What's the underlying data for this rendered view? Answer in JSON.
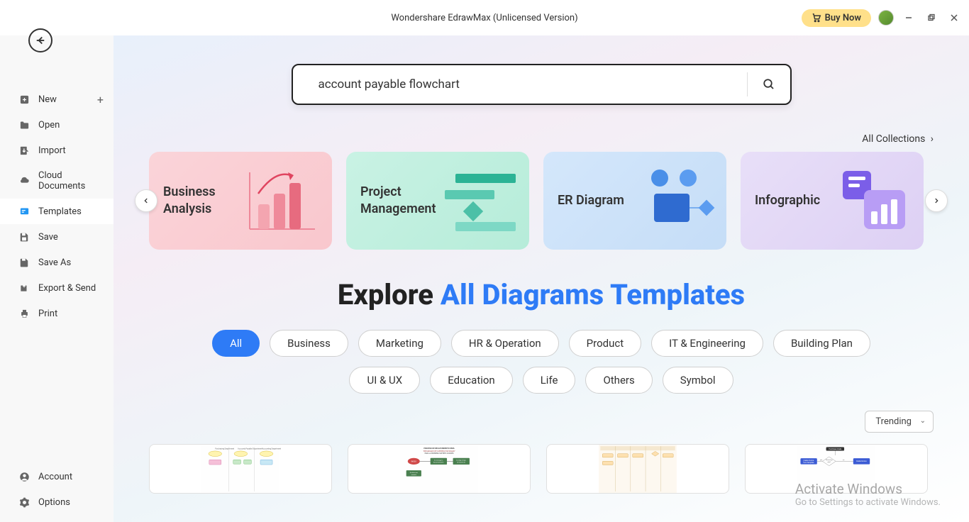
{
  "titlebar": {
    "title": "Wondershare EdrawMax (Unlicensed Version)",
    "buy_now": "Buy Now"
  },
  "sidebar": {
    "items": [
      {
        "label": "New"
      },
      {
        "label": "Open"
      },
      {
        "label": "Import"
      },
      {
        "label": "Cloud Documents"
      },
      {
        "label": "Templates"
      },
      {
        "label": "Save"
      },
      {
        "label": "Save As"
      },
      {
        "label": "Export & Send"
      },
      {
        "label": "Print"
      }
    ],
    "bottom": [
      {
        "label": "Account"
      },
      {
        "label": "Options"
      }
    ]
  },
  "search": {
    "value": "account payable flowchart"
  },
  "all_collections": "All Collections",
  "category_cards": [
    {
      "title": "Business Analysis"
    },
    {
      "title": "Project Management"
    },
    {
      "title": "ER Diagram"
    },
    {
      "title": "Infographic"
    }
  ],
  "explore": {
    "prefix": "Explore ",
    "highlight": "All Diagrams Templates"
  },
  "filter_pills": [
    "All",
    "Business",
    "Marketing",
    "HR & Operation",
    "Product",
    "IT & Engineering",
    "Building Plan",
    "UI & UX",
    "Education",
    "Life",
    "Others",
    "Symbol"
  ],
  "sort": {
    "selected": "Trending"
  },
  "watermark": {
    "title": "Activate Windows",
    "subtitle": "Go to Settings to activate Windows."
  }
}
